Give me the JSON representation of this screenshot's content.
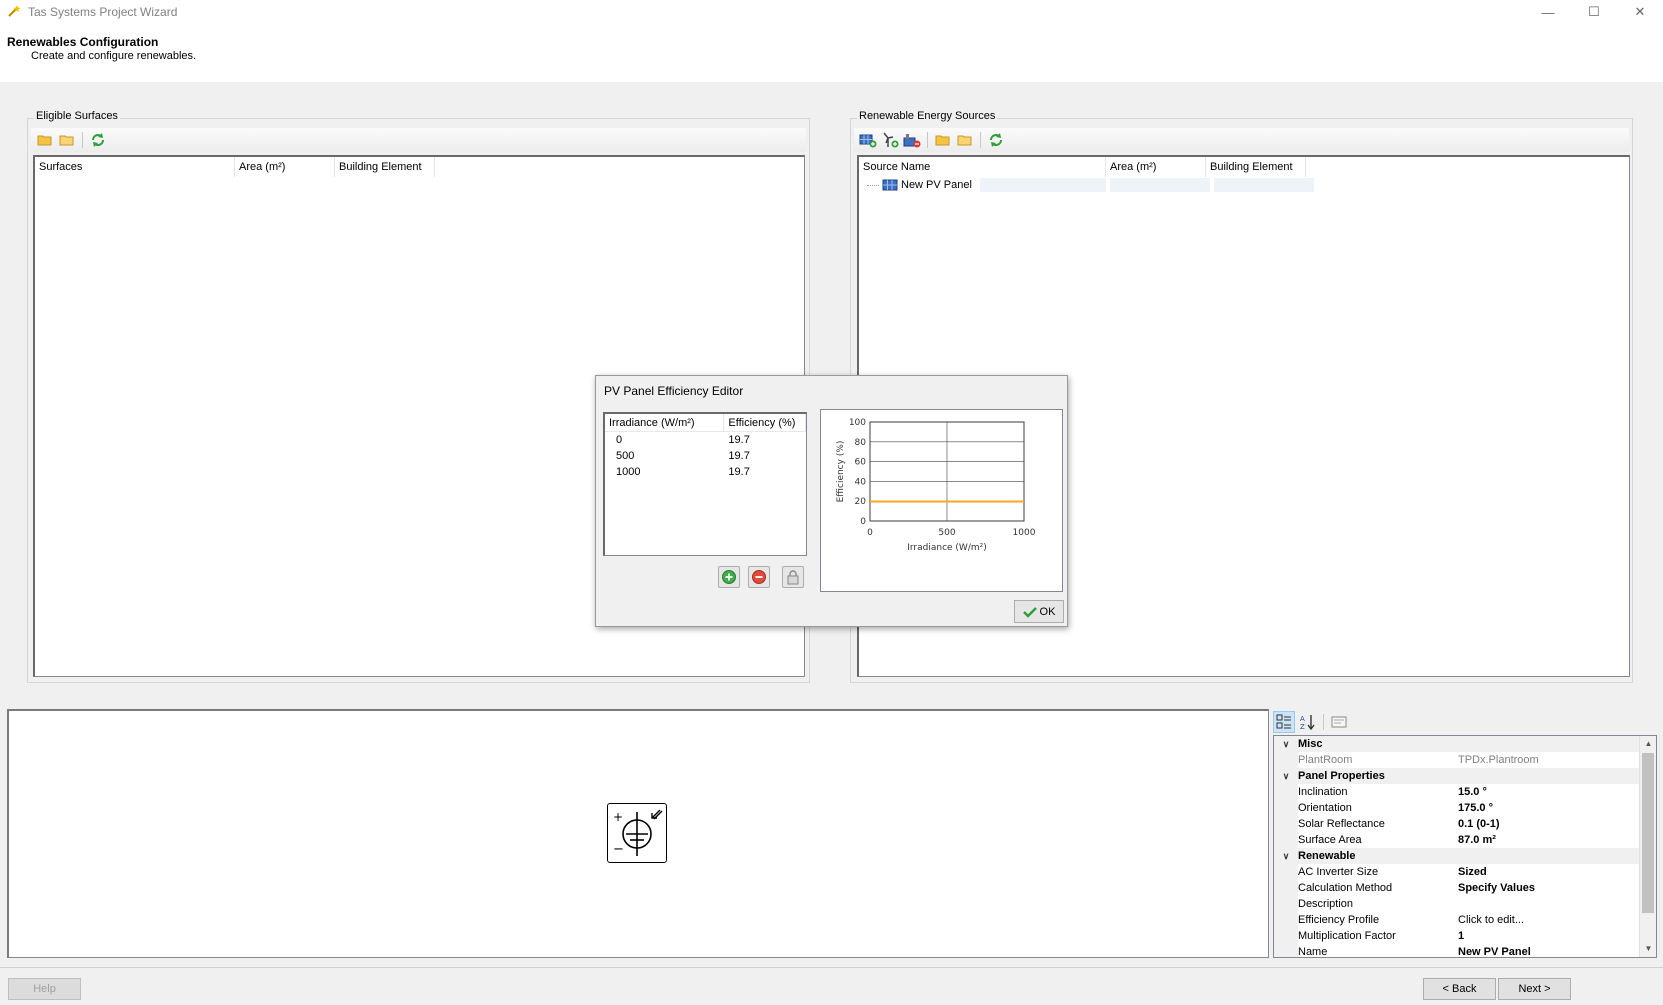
{
  "window": {
    "title": "Tas Systems Project Wizard",
    "minimize_glyph": "—",
    "maximize_glyph": "☐",
    "close_glyph": "✕"
  },
  "header": {
    "title": "Renewables Configuration",
    "subtitle": "Create and configure renewables."
  },
  "eligible_surfaces": {
    "label": "Eligible Surfaces",
    "toolbar_icons": [
      "folder-open-icon",
      "folder-icon",
      "refresh-icon"
    ],
    "columns": [
      "Surfaces",
      "Area (m²)",
      "Building Element"
    ],
    "rows": []
  },
  "renewable_sources": {
    "label": "Renewable Energy Sources",
    "toolbar_icons": [
      "add-pv-panel-icon",
      "add-wind-turbine-icon",
      "add-chp-icon",
      "folder-open-icon",
      "folder-icon",
      "refresh-icon"
    ],
    "columns": [
      "Source Name",
      "Area (m²)",
      "Building Element"
    ],
    "rows": [
      {
        "name": "New PV Panel",
        "area": "",
        "element": ""
      }
    ]
  },
  "property_grid": {
    "categories": [
      {
        "name": "Misc",
        "properties": [
          {
            "name": "PlantRoom",
            "value": "TPDx.Plantroom",
            "readonly": true,
            "bold": false
          }
        ]
      },
      {
        "name": "Panel Properties",
        "properties": [
          {
            "name": "Inclination",
            "value": "15.0 °",
            "readonly": false,
            "bold": true
          },
          {
            "name": "Orientation",
            "value": "175.0 °",
            "readonly": false,
            "bold": true
          },
          {
            "name": "Solar Reflectance",
            "value": "0.1 (0-1)",
            "readonly": false,
            "bold": true
          },
          {
            "name": "Surface Area",
            "value": "87.0 m²",
            "readonly": false,
            "bold": true
          }
        ]
      },
      {
        "name": "Renewable",
        "properties": [
          {
            "name": "AC Inverter Size",
            "value": "Sized",
            "readonly": false,
            "bold": true
          },
          {
            "name": "Calculation Method",
            "value": "Specify Values",
            "readonly": false,
            "bold": true
          },
          {
            "name": "Description",
            "value": "",
            "readonly": false,
            "bold": false
          },
          {
            "name": "Efficiency Profile",
            "value": "Click to edit...",
            "readonly": false,
            "bold": false
          },
          {
            "name": "Multiplication Factor",
            "value": "1",
            "readonly": false,
            "bold": true
          },
          {
            "name": "Name",
            "value": "New PV Panel",
            "readonly": false,
            "bold": true
          }
        ]
      }
    ]
  },
  "footer": {
    "help_label": "Help",
    "back_label": "< Back",
    "next_label": "Next >"
  },
  "dialog": {
    "title": "PV Panel Efficiency Editor",
    "grid_columns": [
      "Irradiance (W/m²)",
      "Efficiency (%)"
    ],
    "grid_rows": [
      {
        "irradiance": "0",
        "efficiency": "19.7"
      },
      {
        "irradiance": "500",
        "efficiency": "19.7"
      },
      {
        "irradiance": "1000",
        "efficiency": "19.7"
      }
    ],
    "ok_label": "OK"
  },
  "chart_data": {
    "type": "line",
    "title": "",
    "xlabel": "Irradiance (W/m²)",
    "ylabel": "Efficiency (%)",
    "xlim": [
      0,
      1000
    ],
    "ylim": [
      0,
      100
    ],
    "xticks": [
      0,
      500,
      1000
    ],
    "yticks": [
      0,
      20,
      40,
      60,
      80,
      100
    ],
    "grid": true,
    "series": [
      {
        "x": [
          0,
          500,
          1000
        ],
        "y": [
          19.7,
          19.7,
          19.7
        ],
        "color": "#f5a623"
      }
    ]
  },
  "colors": {
    "accent": "#0078d7",
    "selection": "#cce4f7",
    "series_line": "#f5a623"
  }
}
